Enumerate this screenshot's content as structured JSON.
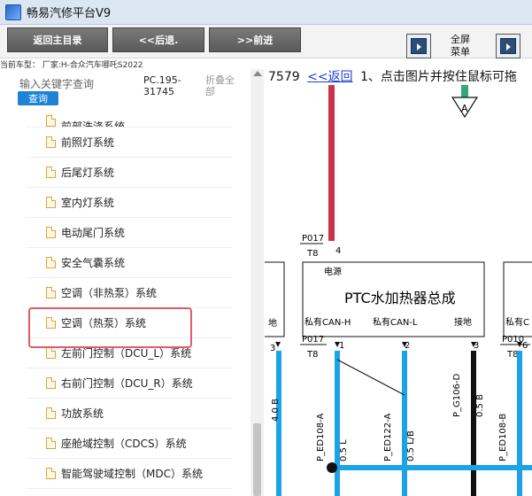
{
  "window": {
    "title": "畅易汽修平台V9"
  },
  "toolbar": {
    "back_home": "返回主目录",
    "prev": "<<后退.",
    "next": ">>前进",
    "full_menu_line1": "全屏",
    "full_menu_line2": "菜单"
  },
  "vehicle_line": "当前车型： 厂家:H-合众汽车哪吒S2022",
  "search": {
    "label": "输入关键字查询",
    "query_button": "查询",
    "pc_code_line1": "PC.195-",
    "pc_code_line2": "31745",
    "collapse_line1": "折叠全",
    "collapse_line2": "部"
  },
  "tree": {
    "items": [
      {
        "label": "前部洗涤系统"
      },
      {
        "label": "前照灯系统"
      },
      {
        "label": "后尾灯系统"
      },
      {
        "label": "室内灯系统"
      },
      {
        "label": "电动尾门系统"
      },
      {
        "label": "安全气囊系统"
      },
      {
        "label": "空调（非热泵）系统"
      },
      {
        "label": "空调（热泵）系统"
      },
      {
        "label": "左前门控制（DCU_L）系统"
      },
      {
        "label": "右前门控制（DCU_R）系统"
      },
      {
        "label": "功放系统"
      },
      {
        "label": "座舱域控制（CDCS）系统"
      },
      {
        "label": "智能驾驶域控制（MDC）系统"
      }
    ]
  },
  "diagram": {
    "header_num": "7579",
    "header_back": "<<返回",
    "header_instruction": "1、点击图片并按住鼠标可拖",
    "connector_A": "A",
    "p017_top": "P017",
    "t8_top": "T8",
    "pin4": "4",
    "box_power": "电源",
    "box_title": "PTC水加热器总成",
    "can_h": "私有CAN-H",
    "can_l": "私有CAN-L",
    "ground": "接地",
    "p017_bottom": "P017",
    "t8_bottom": "T8",
    "pin1": "1",
    "pin2": "2",
    "pin3": "3",
    "left_pin3": "3",
    "left_box_label": "地",
    "right_box_label": "私有C",
    "p010": "P010",
    "t8_right": "T8",
    "pin6": "6",
    "wire_4_0b": "4.0 B",
    "wire_ed108a": "P_ED108-A",
    "wire_05l": "0.5 L",
    "wire_ed122a": "P_ED122-A",
    "wire_05lb": "0.5 L/B",
    "wire_g106d": "P_G106-D",
    "wire_05b": "0.5 B",
    "wire_ed108b": "P_ED108-B"
  }
}
